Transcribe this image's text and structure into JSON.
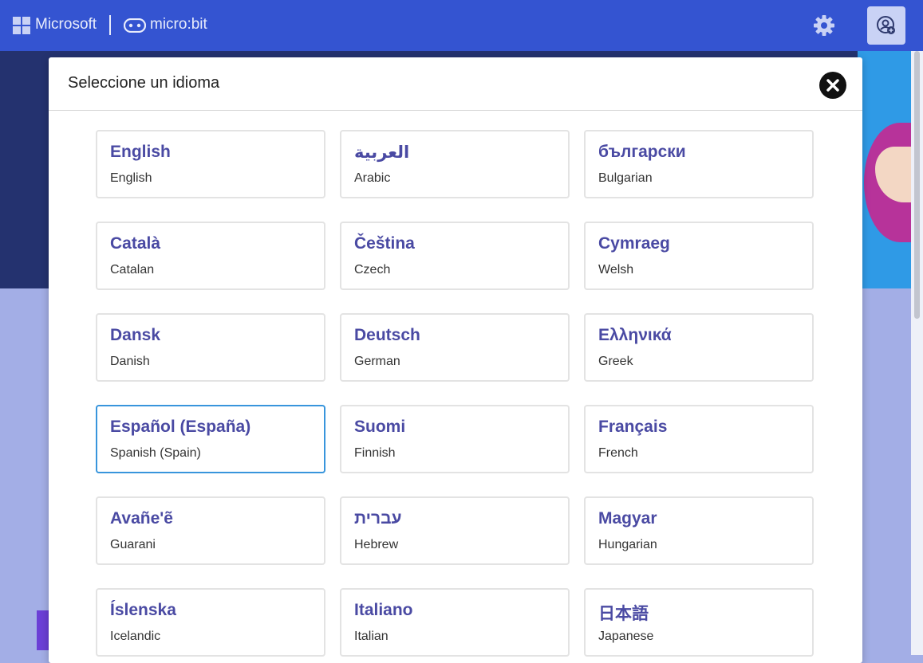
{
  "header": {
    "microsoft_label": "Microsoft",
    "microbit_label": "micro:bit",
    "settings_icon": "gear-icon",
    "user_icon": "user-icon",
    "colors": {
      "bar": "#3454d1",
      "accent": "#4a4aa3",
      "selected_border": "#3895dc"
    }
  },
  "modal": {
    "title": "Seleccione un idioma",
    "close_icon": "close-icon",
    "languages": [
      {
        "native": "English",
        "english": "English"
      },
      {
        "native": "العربية",
        "english": "Arabic"
      },
      {
        "native": "български",
        "english": "Bulgarian"
      },
      {
        "native": "Català",
        "english": "Catalan"
      },
      {
        "native": "Čeština",
        "english": "Czech"
      },
      {
        "native": "Cymraeg",
        "english": "Welsh"
      },
      {
        "native": "Dansk",
        "english": "Danish"
      },
      {
        "native": "Deutsch",
        "english": "German"
      },
      {
        "native": "Ελληνικά",
        "english": "Greek"
      },
      {
        "native": "Español (España)",
        "english": "Spanish (Spain)",
        "selected": true
      },
      {
        "native": "Suomi",
        "english": "Finnish"
      },
      {
        "native": "Français",
        "english": "French"
      },
      {
        "native": "Avañe'ẽ",
        "english": "Guarani"
      },
      {
        "native": "עברית",
        "english": "Hebrew"
      },
      {
        "native": "Magyar",
        "english": "Hungarian"
      },
      {
        "native": "Íslenska",
        "english": "Icelandic"
      },
      {
        "native": "Italiano",
        "english": "Italian"
      },
      {
        "native": "日本語",
        "english": "Japanese"
      }
    ]
  }
}
